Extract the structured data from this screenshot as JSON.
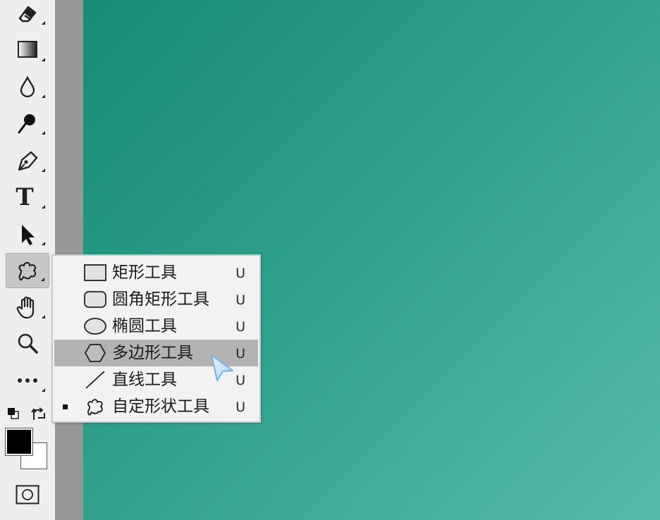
{
  "toolbar": {
    "tools": [
      {
        "name": "eraser-tool-icon"
      },
      {
        "name": "gradient-tool-icon"
      },
      {
        "name": "blur-tool-icon"
      },
      {
        "name": "dodge-tool-icon"
      },
      {
        "name": "pen-tool-icon"
      },
      {
        "name": "type-tool-icon",
        "glyph": "T"
      },
      {
        "name": "path-selection-tool-icon"
      },
      {
        "name": "custom-shape-tool-icon",
        "active": true
      },
      {
        "name": "hand-tool-icon"
      },
      {
        "name": "zoom-tool-icon"
      },
      {
        "name": "more-tools-icon"
      }
    ],
    "colors": {
      "foreground": "#000000",
      "background": "#ffffff"
    }
  },
  "flyout_menu": {
    "items": [
      {
        "label": "矩形工具",
        "shortcut": "U",
        "icon": "rectangle-icon"
      },
      {
        "label": "圆角矩形工具",
        "shortcut": "U",
        "icon": "rounded-rectangle-icon"
      },
      {
        "label": "椭圆工具",
        "shortcut": "U",
        "icon": "ellipse-icon"
      },
      {
        "label": "多边形工具",
        "shortcut": "U",
        "icon": "polygon-icon",
        "highlighted": true
      },
      {
        "label": "直线工具",
        "shortcut": "U",
        "icon": "line-icon"
      },
      {
        "label": "自定形状工具",
        "shortcut": "U",
        "icon": "custom-shape-icon",
        "selected": true
      }
    ]
  },
  "canvas": {
    "gradient_start": "#158b78",
    "gradient_end": "#55bca8"
  }
}
